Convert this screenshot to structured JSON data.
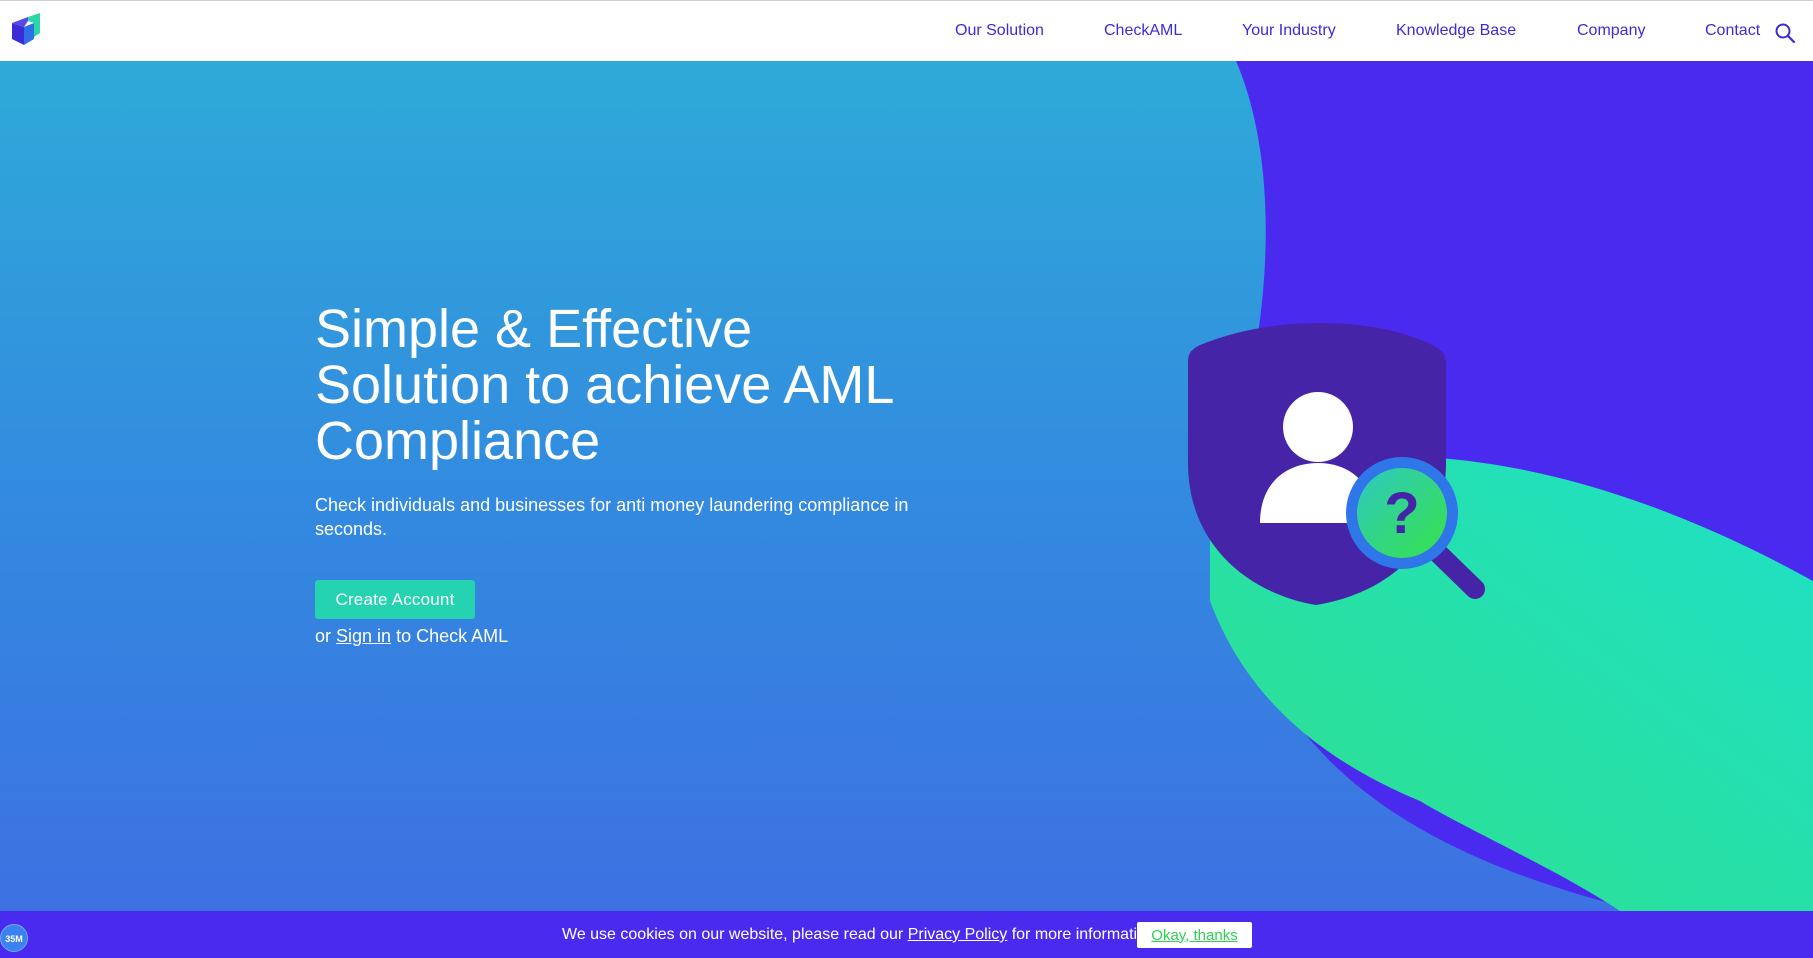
{
  "header": {
    "nav": [
      {
        "label": "Our Solution"
      },
      {
        "label": "CheckAML"
      },
      {
        "label": "Your Industry"
      },
      {
        "label": "Knowledge Base"
      },
      {
        "label": "Company"
      },
      {
        "label": "Contact"
      }
    ],
    "search_icon": "search-icon",
    "logo_icon": "cube-logo-icon"
  },
  "hero": {
    "title_line1": "Simple & Effective",
    "title_line2": "Solution to achieve AML",
    "title_line3": "Compliance",
    "subtitle": "Check individuals and businesses for anti money laundering compliance in seconds.",
    "create_button": "Create Account",
    "signin_prefix": "or ",
    "signin_link": "Sign in",
    "signin_suffix": " to Check AML",
    "illustration_icon": "shield-user-magnifier-icon",
    "question_mark": "?"
  },
  "cookie_bar": {
    "text_before": "We use cookies on our website, please read our ",
    "privacy_link": "Privacy Policy",
    "text_after": " for more information",
    "button": "Okay, thanks"
  },
  "badge": {
    "label": "35M"
  },
  "colors": {
    "nav_text": "#3d2bd8",
    "hero_blue": "#2eaad8",
    "purple": "#4b2af0",
    "teal": "#26d3b0",
    "shield": "#4524a8",
    "cookie_button_text": "#2ed151"
  }
}
